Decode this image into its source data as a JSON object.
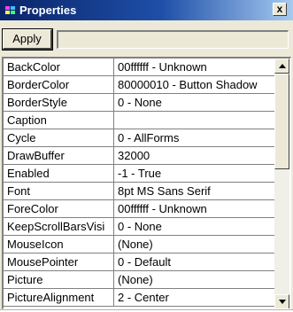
{
  "window": {
    "title": "Properties",
    "close_label": "x"
  },
  "toolbar": {
    "apply_label": "Apply",
    "value_field": ""
  },
  "properties": [
    {
      "name": "BackColor",
      "value": "00ffffff - Unknown"
    },
    {
      "name": "BorderColor",
      "value": "80000010 - Button Shadow"
    },
    {
      "name": "BorderStyle",
      "value": "0 - None"
    },
    {
      "name": "Caption",
      "value": ""
    },
    {
      "name": "Cycle",
      "value": "0 - AllForms"
    },
    {
      "name": "DrawBuffer",
      "value": "32000"
    },
    {
      "name": "Enabled",
      "value": "-1 - True"
    },
    {
      "name": "Font",
      "value": "8pt MS Sans Serif"
    },
    {
      "name": "ForeColor",
      "value": "00ffffff - Unknown"
    },
    {
      "name": "KeepScrollBarsVisi",
      "value": "0 - None"
    },
    {
      "name": "MouseIcon",
      "value": "(None)"
    },
    {
      "name": "MousePointer",
      "value": "0 - Default"
    },
    {
      "name": "Picture",
      "value": "(None)"
    },
    {
      "name": "PictureAlignment",
      "value": "2 - Center"
    }
  ],
  "scrollbar": {
    "position": 0
  },
  "icons": {
    "window_icon": "properties-window-icon",
    "close": "close-icon",
    "scroll_up": "arrow-up-icon",
    "scroll_down": "arrow-down-icon"
  },
  "colors": {
    "titlebar_start": "#0a246a",
    "titlebar_end": "#a6caf0",
    "face": "#ece9d8",
    "grid_lines": "#808080"
  }
}
